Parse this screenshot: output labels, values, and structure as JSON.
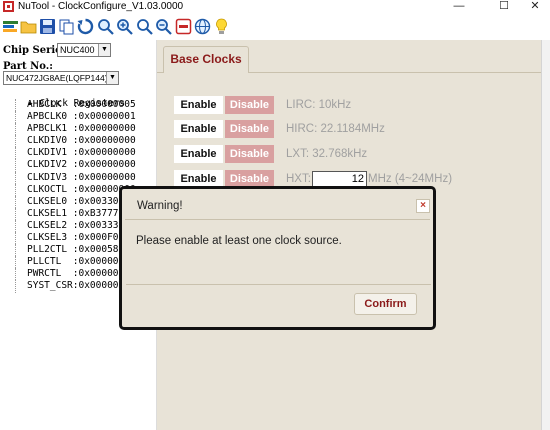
{
  "window": {
    "title": "NuTool - ClockConfigure_V1.03.0000",
    "minimize": "—",
    "maximize": "☐",
    "close": "✕"
  },
  "toolbar": {
    "icons": [
      "bars-chart-icon",
      "open-folder-icon",
      "save-disk-icon",
      "copy-icon",
      "refresh-icon",
      "zoom-icon",
      "zoom-in-icon",
      "search-icon",
      "zoom-out-icon",
      "stop-icon",
      "globe-icon",
      "lightbulb-icon"
    ]
  },
  "left": {
    "chip_series_label": "Chip Series:",
    "chip_series_value": "NUC400",
    "part_no_label": "Part No.:",
    "part_no_value": "NUC472JG8AE(LQFP144)",
    "tree_root": "Clock Registers",
    "registers": [
      {
        "text": "AHBCLK  :0x00000005"
      },
      {
        "text": "APBCLK0 :0x00000001"
      },
      {
        "text": "APBCLK1 :0x00000000"
      },
      {
        "text": "CLKDIV0 :0x00000000"
      },
      {
        "text": "CLKDIV1 :0x00000000"
      },
      {
        "text": "CLKDIV2 :0x00000000"
      },
      {
        "text": "CLKDIV3 :0x00000000"
      },
      {
        "text": "CLKOCTL :0x00000000"
      },
      {
        "text": "CLKSEL0 :0x003305"
      },
      {
        "text": "CLKSEL1 :0xB37777"
      },
      {
        "text": "CLKSEL2 :0x003333"
      },
      {
        "text": "CLKSEL3 :0x000F0F"
      },
      {
        "text": "PLL2CTL :0x000582"
      },
      {
        "text": "PLLCTL  :0x000000"
      },
      {
        "text": "PWRCTL  :0x000000"
      },
      {
        "text": "SYST_CSR:0x000000"
      }
    ]
  },
  "right": {
    "tab_label": "Base Clocks",
    "enable_label": "Enable",
    "disable_label": "Disable",
    "rows": [
      {
        "label": "LIRC: 10kHz"
      },
      {
        "label": "HIRC: 22.1184MHz"
      },
      {
        "label": "LXT: 32.768kHz"
      }
    ],
    "hxt_label": "HXT:",
    "hxt_value": "12",
    "hxt_unit": "MHz (4~24MHz)"
  },
  "dialog": {
    "title": "Warning!",
    "close": "×",
    "message": "Please enable at least one clock source.",
    "confirm_label": "Confirm"
  }
}
